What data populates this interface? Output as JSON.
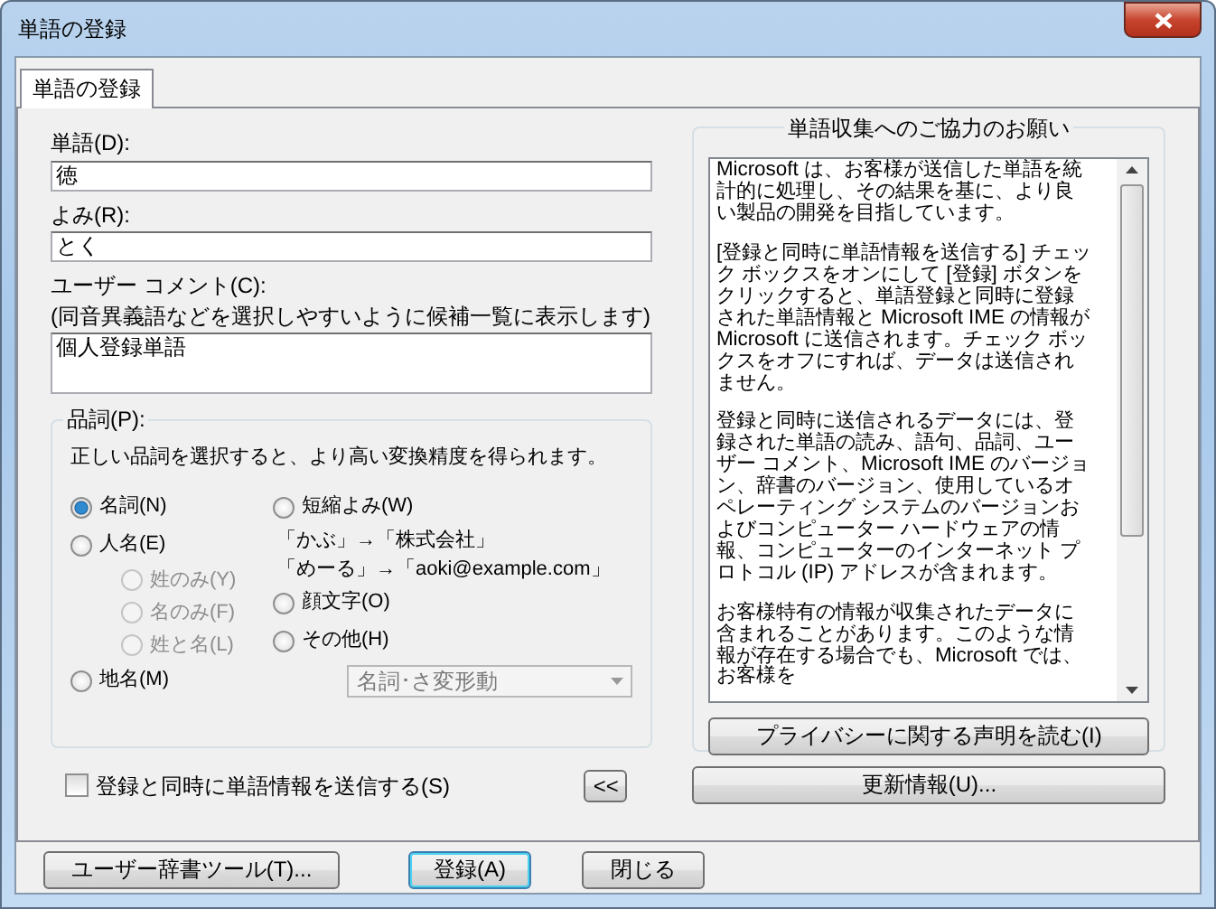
{
  "window": {
    "title": "単語の登録"
  },
  "tabs": [
    {
      "label": "単語の登録",
      "selected": true
    }
  ],
  "fields": [
    {
      "label": "単語(D):",
      "value": "徳"
    },
    {
      "label": "よみ(R):",
      "value": "とく"
    }
  ],
  "comment": {
    "label": "ユーザー コメント(C):",
    "note": "(同音異義語などを選択しやすいように候補一覧に表示します)",
    "value": "個人登録単語"
  },
  "pos": {
    "title": "品詞(P):",
    "description": "正しい品詞を選択すると、より高い変換精度を得られます。",
    "left": [
      {
        "kind": "radio",
        "label": "名詞(N)",
        "selected": true,
        "disabled": false
      },
      {
        "kind": "radio",
        "label": "人名(E)",
        "selected": false,
        "disabled": false
      },
      {
        "kind": "subradio",
        "label": "姓のみ(Y)",
        "selected": false,
        "disabled": true
      },
      {
        "kind": "subradio",
        "label": "名のみ(F)",
        "selected": false,
        "disabled": true
      },
      {
        "kind": "subradio",
        "label": "姓と名(L)",
        "selected": false,
        "disabled": true
      },
      {
        "kind": "radio",
        "label": "地名(M)",
        "selected": false,
        "disabled": false
      }
    ],
    "right": [
      {
        "kind": "radio",
        "label": "短縮よみ(W)",
        "selected": false,
        "disabled": false
      },
      {
        "kind": "note",
        "label": "「かぶ」→「株式会社」"
      },
      {
        "kind": "note",
        "label": "「めーる」→「aoki@example.com」"
      },
      {
        "kind": "radio",
        "label": "顔文字(O)",
        "selected": false,
        "disabled": false
      },
      {
        "kind": "radio",
        "label": "その他(H)",
        "selected": false,
        "disabled": false
      }
    ],
    "dropdown": {
      "value": "名詞･さ変形動",
      "disabled": true
    }
  },
  "send_checkbox": {
    "label": "登録と同時に単語情報を送信する(S)",
    "checked": false
  },
  "collapse_button": {
    "label": "<<"
  },
  "info": {
    "title": "単語収集へのご協力のお願い",
    "paragraphs": [
      "Microsoft は、お客様が送信した単語を統計的に処理し、その結果を基に、より良い製品の開発を目指しています。",
      "[登録と同時に単語情報を送信する] チェック ボックスをオンにして [登録] ボタンをクリックすると、単語登録と同時に登録された単語情報と Microsoft IME の情報が Microsoft に送信されます。チェック ボックスをオフにすれば、データは送信されません。",
      "登録と同時に送信されるデータには、登録された単語の読み、語句、品詞、ユーザー コメント、Microsoft IME のバージョン、辞書のバージョン、使用しているオペレーティング システムのバージョンおよびコンピューター ハードウェアの情報、コンピューターのインターネット プロトコル (IP) アドレスが含まれます。",
      "お客様特有の情報が収集されたデータに含まれることがあります。このような情報が存在する場合でも、Microsoft では、お客様を"
    ],
    "button": "プライバシーに関する声明を読む(I)"
  },
  "update_button": "更新情報(U)...",
  "footer_buttons": [
    {
      "label": "ユーザー辞書ツール(T)...",
      "default": false
    },
    {
      "label": "登録(A)",
      "default": true
    },
    {
      "label": "閉じる",
      "default": false
    }
  ]
}
